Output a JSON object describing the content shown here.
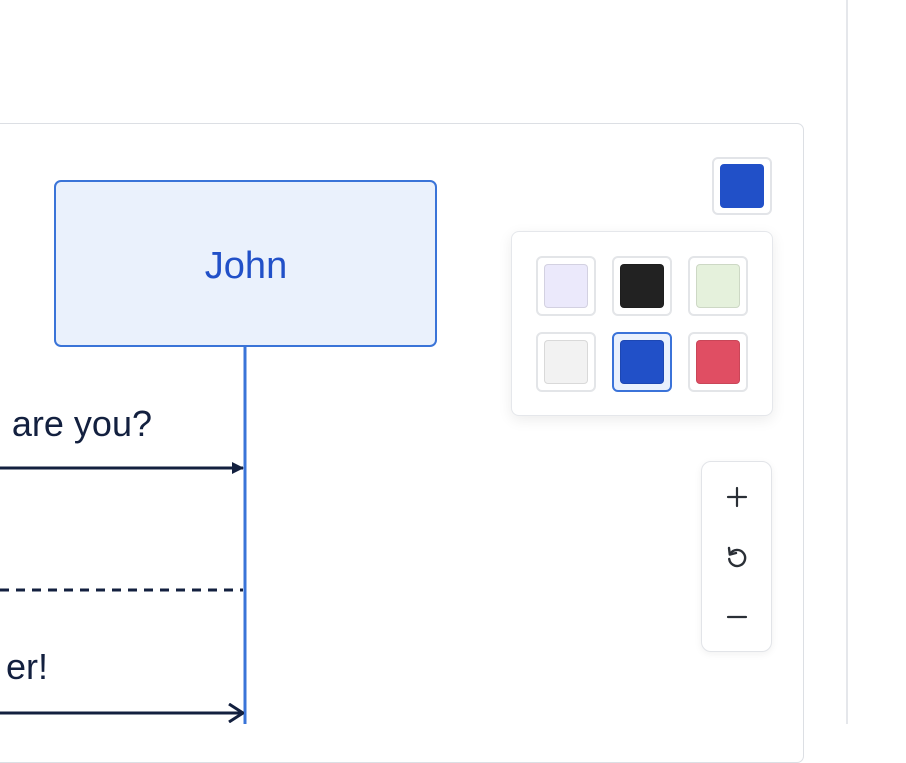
{
  "diagram": {
    "actor": {
      "name": "John"
    },
    "messages": [
      {
        "text": "are you?"
      },
      {
        "text": "er!"
      }
    ]
  },
  "color_picker": {
    "current": "#2150c8",
    "options": [
      "#ebe9fb",
      "#222222",
      "#e5f1dc",
      "#f2f2f2",
      "#2150c8",
      "#e04e63"
    ],
    "selected_index": 4
  },
  "zoom_controls": {
    "zoom_in_icon": "plus-icon",
    "reset_icon": "rotate-ccw-icon",
    "zoom_out_icon": "minus-icon"
  },
  "colors": {
    "actor_fill": "#eaf1fc",
    "actor_stroke": "#3a74d8",
    "actor_text": "#2150c8",
    "message_line": "#13203f"
  }
}
